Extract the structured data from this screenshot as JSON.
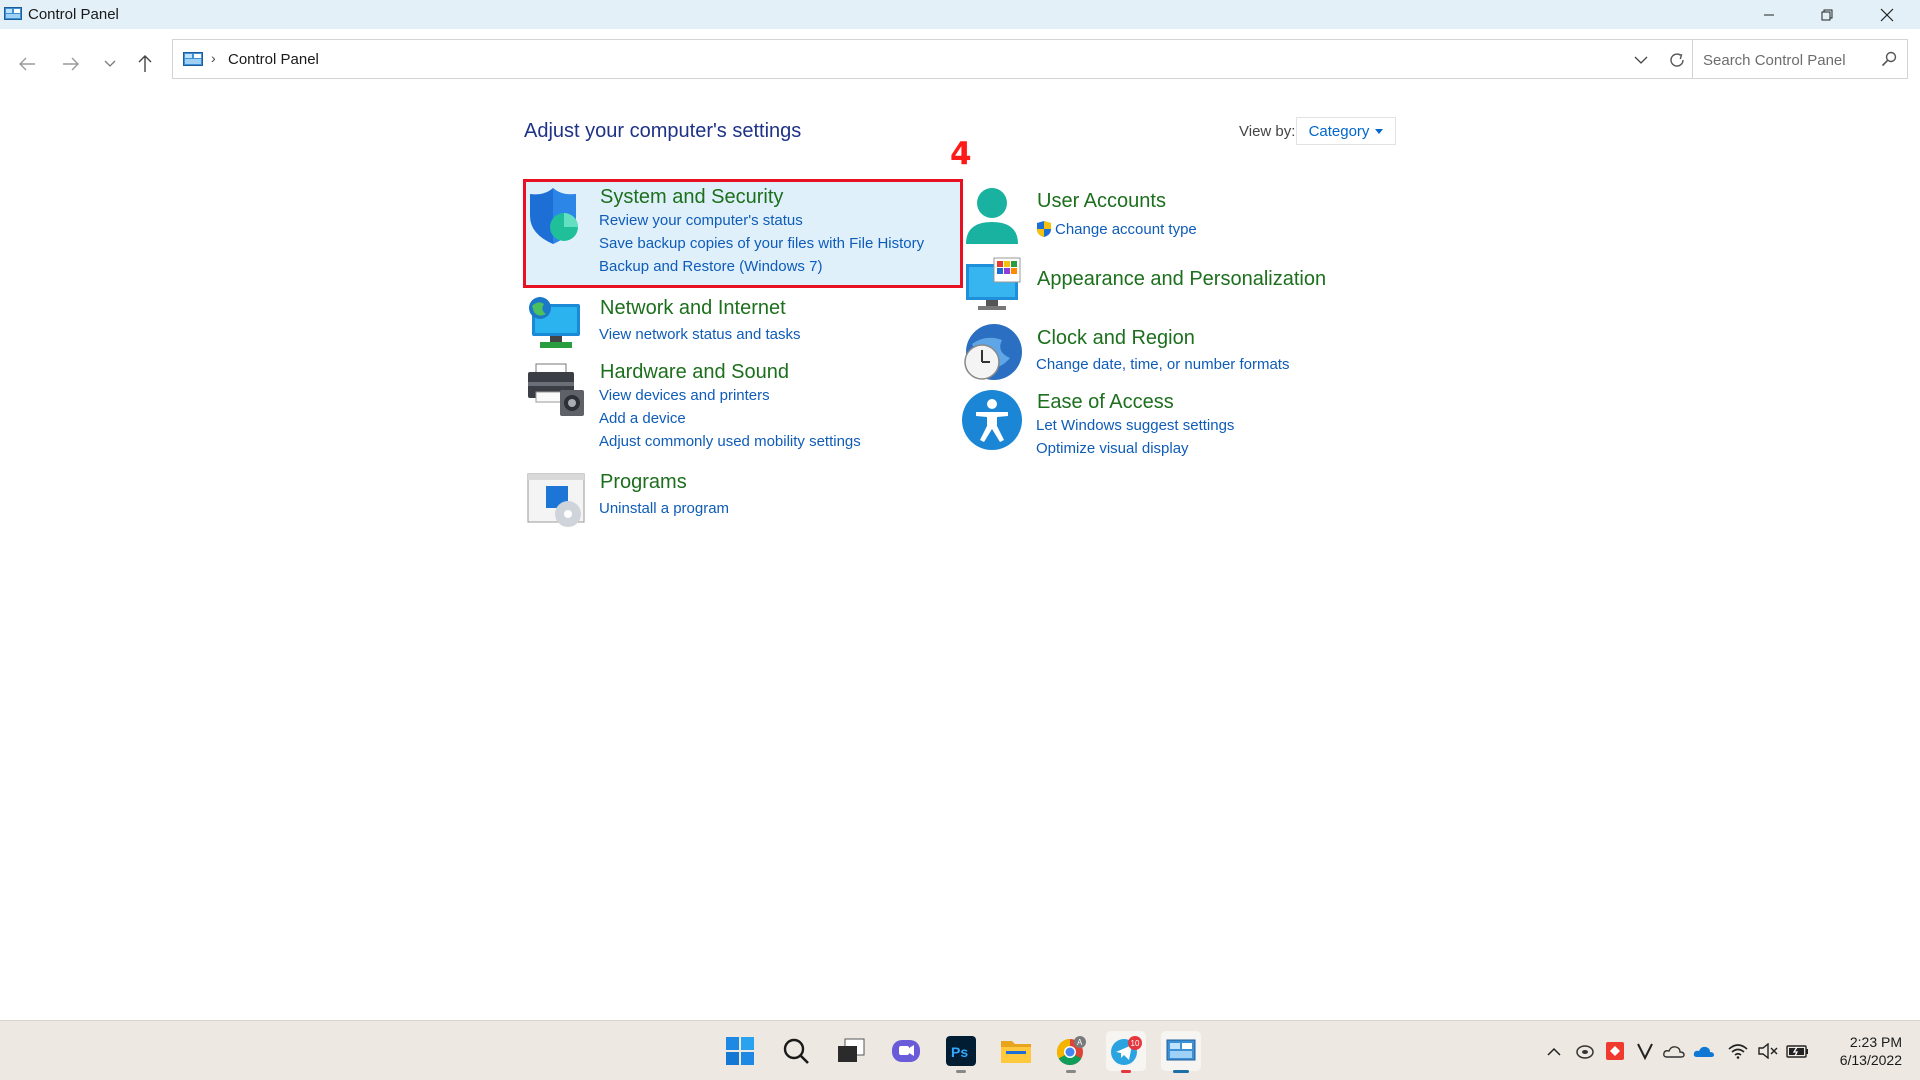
{
  "window": {
    "title": "Control Panel"
  },
  "address": {
    "crumb": "Control Panel",
    "separator": "›"
  },
  "search": {
    "placeholder": "Search Control Panel"
  },
  "content": {
    "heading": "Adjust your computer's settings",
    "view_by_label": "View by:",
    "view_by_value": "Category",
    "annotation": "4"
  },
  "categories": [
    {
      "title": "System and Security",
      "links": [
        "Review your computer's status",
        "Save backup copies of your files with File History",
        "Backup and Restore (Windows 7)"
      ]
    },
    {
      "title": "Network and Internet",
      "links": [
        "View network status and tasks"
      ]
    },
    {
      "title": "Hardware and Sound",
      "links": [
        "View devices and printers",
        "Add a device",
        "Adjust commonly used mobility settings"
      ]
    },
    {
      "title": "Programs",
      "links": [
        "Uninstall a program"
      ]
    },
    {
      "title": "User Accounts",
      "links": [
        "Change account type"
      ]
    },
    {
      "title": "Appearance and Personalization",
      "links": []
    },
    {
      "title": "Clock and Region",
      "links": [
        "Change date, time, or number formats"
      ]
    },
    {
      "title": "Ease of Access",
      "links": [
        "Let Windows suggest settings",
        "Optimize visual display"
      ]
    }
  ],
  "taskbar": {
    "apps": [
      "start",
      "search",
      "task-view",
      "chat",
      "photoshop",
      "file-explorer",
      "chrome",
      "telegram",
      "control-panel"
    ],
    "telegram_badge": "10",
    "chrome_badge": "A",
    "photoshop_label": "Ps",
    "time": "2:23 PM",
    "date": "6/13/2022"
  },
  "colors": {
    "accent_link": "#0f5cb8",
    "category_title": "#1c6f1c",
    "heading": "#1e3287",
    "highlight_border": "#e81123",
    "highlight_fill": "#dff0fb",
    "titlebar": "#e3f0f8"
  }
}
